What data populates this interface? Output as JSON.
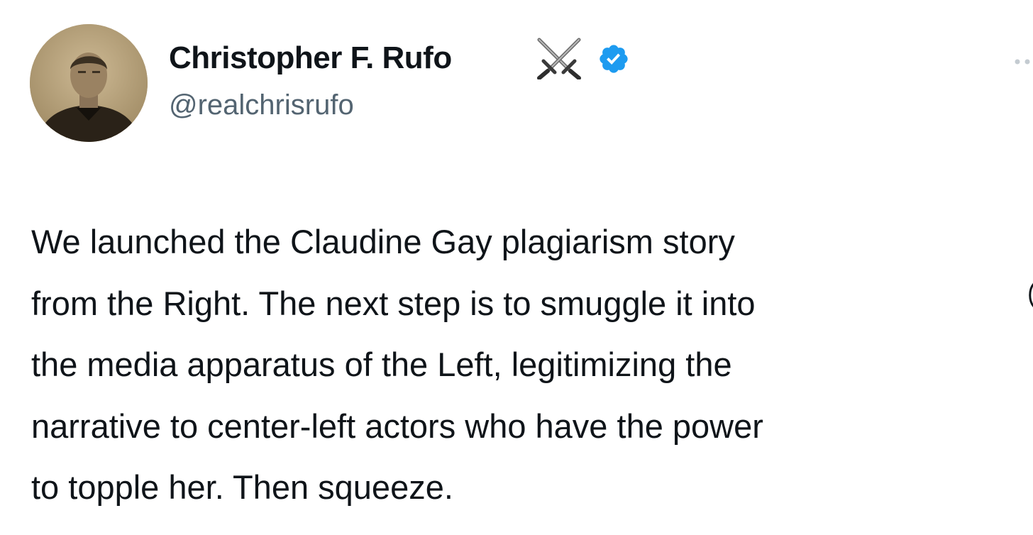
{
  "tweet": {
    "author": {
      "display_name": "Christopher F. Rufo",
      "name_emoji": "crossed-swords-icon",
      "verified_badge": "verified-checkmark-icon",
      "handle": "@realchrisrufo"
    },
    "text": "We launched the Claudine Gay plagiarism story\nfrom the Right. The next step is to smuggle it into\nthe media apparatus of the Left, legitimizing the\nnarrative to center-left actors who have the power\nto topple her. Then squeeze.",
    "more_menu_icon": "more-horizontal-icon"
  },
  "colors": {
    "text_primary": "#0f1419",
    "text_secondary": "#536471",
    "verified_blue": "#1d9bf0",
    "background": "#ffffff"
  }
}
